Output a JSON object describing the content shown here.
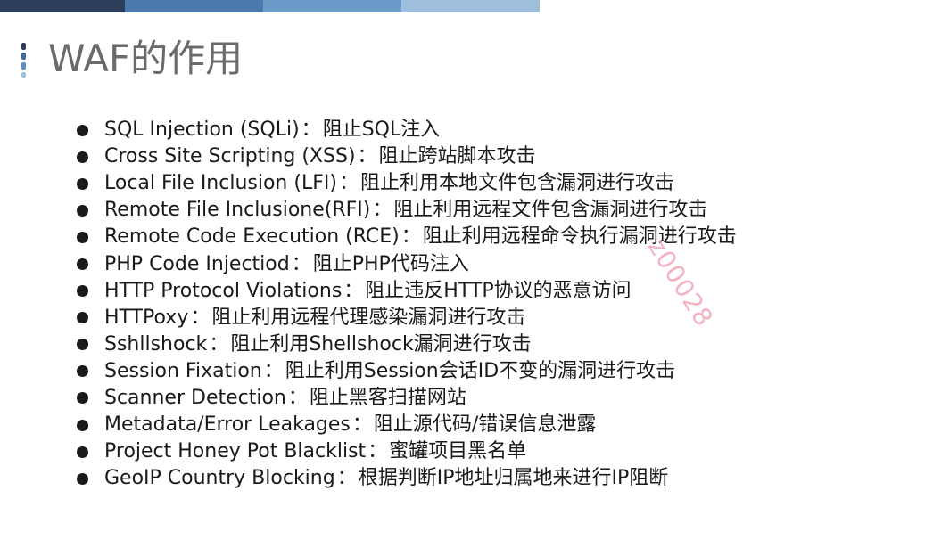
{
  "slide": {
    "title": "WAF的作用",
    "watermark": "z00028",
    "items": [
      {
        "term": "SQL Injection (SQLi)",
        "sep": "：",
        "desc": "阻止SQL注入"
      },
      {
        "term": "Cross Site Scripting (XSS)",
        "sep": "：",
        "desc": "阻止跨站脚本攻击"
      },
      {
        "term": "Local File Inclusion (LFI)",
        "sep": "：",
        "desc": "阻止利用本地文件包含漏洞进行攻击"
      },
      {
        "term": "Remote File Inclusione(RFI)",
        "sep": "：",
        "desc": "阻止利用远程文件包含漏洞进行攻击"
      },
      {
        "term": "Remote Code Execution (RCE)",
        "sep": "：",
        "desc": "阻止利用远程命令执行漏洞进行攻击"
      },
      {
        "term": "PHP Code Injectiod",
        "sep": "：",
        "desc": "阻止PHP代码注入"
      },
      {
        "term": "HTTP Protocol Violations",
        "sep": "：",
        "desc": "阻止违反HTTP协议的恶意访问"
      },
      {
        "term": "HTTPoxy",
        "sep": "：",
        "desc": "阻止利用远程代理感染漏洞进行攻击"
      },
      {
        "term": "Sshllshock",
        "sep": "：",
        "desc": "阻止利用Shellshock漏洞进行攻击"
      },
      {
        "term": "Session Fixation",
        "sep": "：",
        "desc": "阻止利用Session会话ID不变的漏洞进行攻击"
      },
      {
        "term": "Scanner Detection",
        "sep": "：",
        "desc": "阻止黑客扫描网站"
      },
      {
        "term": "Metadata/Error Leakages",
        "sep": "：",
        "desc": "阻止源代码/错误信息泄露"
      },
      {
        "term": "Project Honey Pot Blacklist",
        "sep": "：",
        "desc": "蜜罐项目黑名单"
      },
      {
        "term": "GeoIP Country Blocking",
        "sep": "：",
        "desc": "根据判断IP地址归属地来进行IP阻断"
      }
    ]
  }
}
